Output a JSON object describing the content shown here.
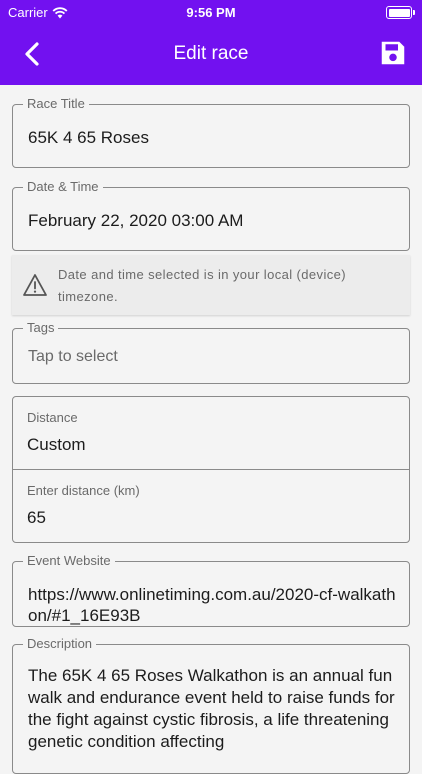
{
  "status_bar": {
    "carrier": "Carrier",
    "time": "9:56 PM"
  },
  "nav": {
    "title": "Edit race",
    "back_icon": "chevron-left-icon",
    "save_icon": "floppy-disk-icon"
  },
  "colors": {
    "header": "#7211f0",
    "background": "#f4f4f4"
  },
  "form": {
    "race_title": {
      "label": "Race Title",
      "value": "65K 4 65 Roses"
    },
    "date_time": {
      "label": "Date & Time",
      "value": "February 22, 2020 03:00 AM"
    },
    "timezone_note": "Date and time selected is in your local (device) timezone.",
    "tags": {
      "label": "Tags",
      "placeholder": "Tap to select"
    },
    "distance": {
      "label": "Distance",
      "value": "Custom"
    },
    "custom_distance": {
      "label": "Enter distance (km)",
      "value": "65"
    },
    "website": {
      "label": "Event Website",
      "value": "https://www.onlinetiming.com.au/2020-cf-walkathon/#1_16E93B"
    },
    "description": {
      "label": "Description",
      "value": "The 65K 4 65 Roses Walkathon is an annual fun walk and endurance event held to raise funds for the fight against cystic fibrosis, a life threatening genetic condition affecting"
    }
  }
}
